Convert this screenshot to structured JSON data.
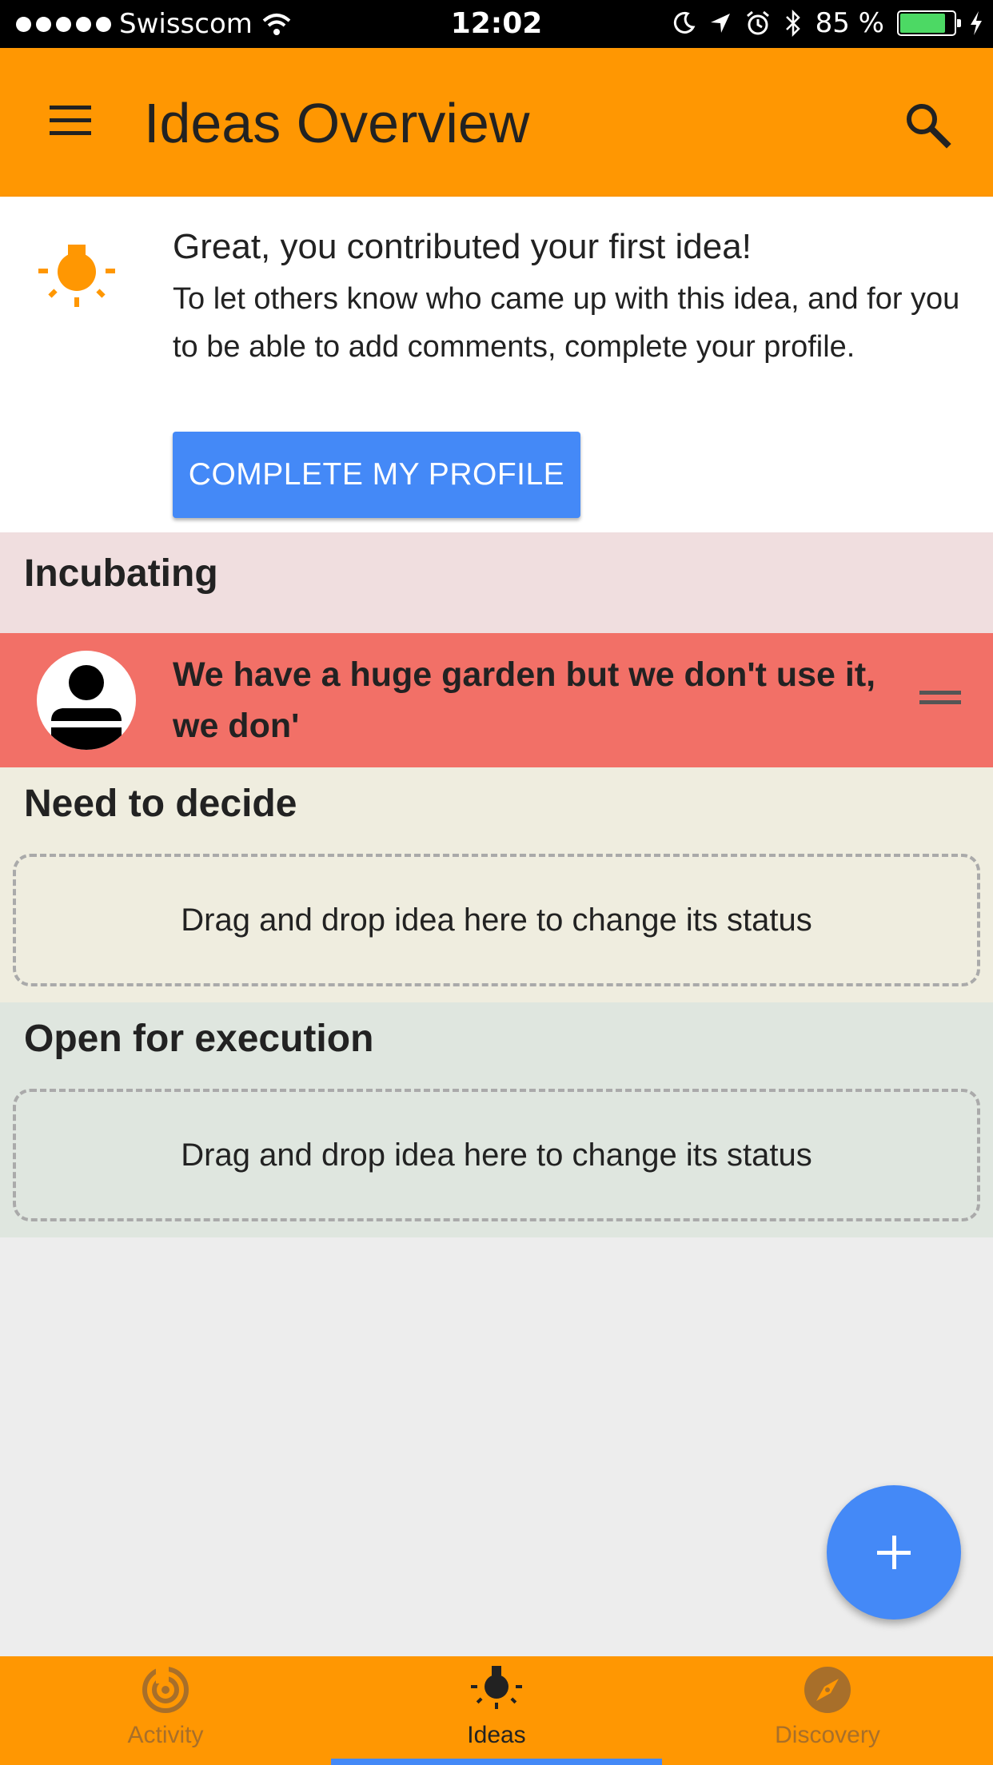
{
  "status_bar": {
    "carrier": "Swisscom",
    "time": "12:02",
    "battery": "85 %",
    "battery_level": 0.85
  },
  "app_bar": {
    "title": "Ideas Overview",
    "menu_icon": "menu-icon",
    "search_icon": "search-icon"
  },
  "notice": {
    "icon": "lightbulb-icon",
    "title": "Great, you contributed your first idea!",
    "body": "To let others know who came up with this idea, and for you to be able to add comments, complete your profile.",
    "button_label": "COMPLETE MY PROFILE"
  },
  "sections": {
    "incubating": {
      "title": "Incubating",
      "ideas": [
        {
          "text": "We have a huge garden but we don't use it, we don'"
        }
      ]
    },
    "need_to_decide": {
      "title": "Need to decide",
      "drop_hint": "Drag and drop idea here to change its status"
    },
    "open_for_execution": {
      "title": "Open for execution",
      "drop_hint": "Drag and drop idea here to change its status"
    }
  },
  "fab": {
    "icon": "plus-icon"
  },
  "bottom_nav": {
    "items": [
      {
        "label": "Activity",
        "icon": "activity-icon"
      },
      {
        "label": "Ideas",
        "icon": "lightbulb-icon"
      },
      {
        "label": "Discovery",
        "icon": "compass-icon"
      }
    ],
    "active": "Ideas"
  },
  "colors": {
    "primary": "#ff9702",
    "accent": "#4489f7",
    "incubating_bg": "#f0dedf",
    "idea_row_bg": "#f27067",
    "need_to_decide_bg": "#efeddf",
    "open_for_execution_bg": "#dfe6df"
  }
}
